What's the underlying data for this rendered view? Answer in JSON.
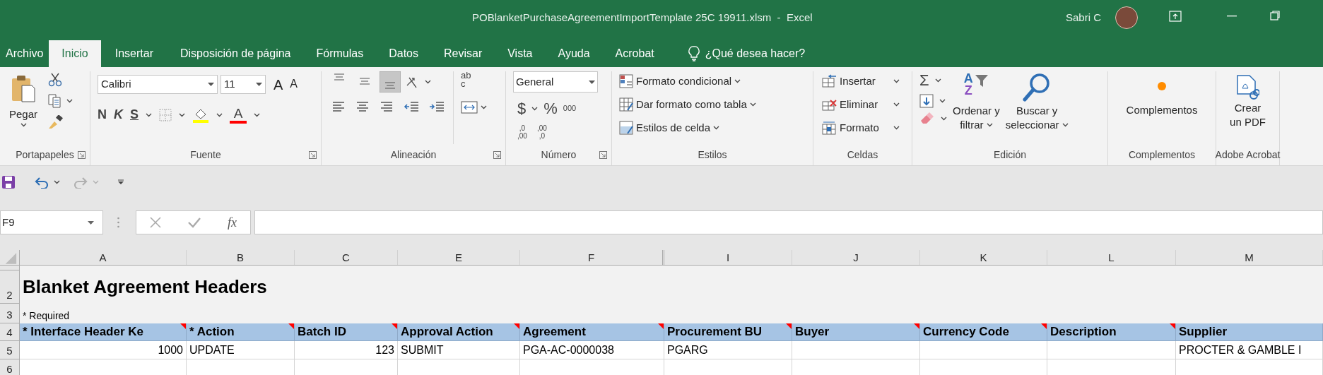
{
  "window": {
    "title": "POBlanketPurchaseAgreementImportTemplate 25C 19911.xlsm  -  Excel",
    "user": "Sabri C"
  },
  "tabs": [
    {
      "label": "Archivo",
      "selected": false
    },
    {
      "label": "Inicio",
      "selected": true
    },
    {
      "label": "Insertar",
      "selected": false
    },
    {
      "label": "Disposición de página",
      "selected": false
    },
    {
      "label": "Fórmulas",
      "selected": false
    },
    {
      "label": "Datos",
      "selected": false
    },
    {
      "label": "Revisar",
      "selected": false
    },
    {
      "label": "Vista",
      "selected": false
    },
    {
      "label": "Ayuda",
      "selected": false
    },
    {
      "label": "Acrobat",
      "selected": false
    }
  ],
  "tell_me": "¿Qué desea hacer?",
  "ribbon": {
    "clipboard": {
      "paste": "Pegar"
    },
    "font": {
      "name": "Calibri",
      "size": "11",
      "grow": "A",
      "shrink": "A",
      "styles": [
        "N",
        "K",
        "S"
      ],
      "color_glyph": "A"
    },
    "alignment": {
      "vertical": [
        {
          "kind": "top",
          "selected": false
        },
        {
          "kind": "middle",
          "selected": false
        },
        {
          "kind": "bottom",
          "selected": true
        }
      ],
      "wrap_glyph": [
        "ab",
        "c"
      ]
    },
    "number": {
      "format": "General",
      "symbols": [
        "$",
        "%",
        "000"
      ],
      "decimals": [
        [
          ",0",
          ",00"
        ],
        [
          ",00",
          ",0"
        ]
      ]
    },
    "styles": [
      "Formato condicional",
      "Dar formato como tabla",
      "Estilos de celda"
    ],
    "cells": [
      "Insertar",
      "Eliminar",
      "Formato"
    ],
    "editing": {
      "sum_glyph": "Σ",
      "sort_glyphs": [
        "A",
        "Z"
      ],
      "sort": [
        "Ordenar y",
        "filtrar"
      ],
      "find": [
        "Buscar y",
        "seleccionar"
      ]
    },
    "addins": "Complementos",
    "acrobat": [
      "Crear",
      "un PDF"
    ],
    "groups": [
      {
        "label": "Portapapeles",
        "launcher": true
      },
      {
        "label": "Fuente",
        "launcher": true
      },
      {
        "label": "Alineación",
        "launcher": true
      },
      {
        "label": "Número",
        "launcher": true
      },
      {
        "label": "Estilos",
        "launcher": false
      },
      {
        "label": "Celdas",
        "launcher": false
      },
      {
        "label": "Edición",
        "launcher": false
      },
      {
        "label": "Complementos",
        "launcher": false
      },
      {
        "label": "Adobe Acrobat",
        "launcher": false
      }
    ]
  },
  "quick_access": {
    "redo_disabled": true
  },
  "formula_bar": {
    "name_box": "F9",
    "fx": "fx"
  },
  "sheet": {
    "columns": [
      "A",
      "B",
      "C",
      "E",
      "F",
      "I",
      "J",
      "K",
      "L",
      "M"
    ],
    "rows": [
      {
        "kind": "spacer"
      },
      {
        "number": "2",
        "kind": "title",
        "text": "Blanket Agreement Headers"
      },
      {
        "number": "3",
        "kind": "note",
        "text": "* Required"
      },
      {
        "number": "4",
        "kind": "header",
        "cells": [
          {
            "text": "* Interface Header Ke",
            "has_comment": true
          },
          {
            "text": "* Action",
            "has_comment": true
          },
          {
            "text": "Batch ID",
            "has_comment": true
          },
          {
            "text": "Approval Action",
            "has_comment": true
          },
          {
            "text": "Agreement",
            "has_comment": true
          },
          {
            "text": "Procurement BU",
            "has_comment": true
          },
          {
            "text": "Buyer",
            "has_comment": true
          },
          {
            "text": "Currency Code",
            "has_comment": true
          },
          {
            "text": "Description",
            "has_comment": true
          },
          {
            "text": "Supplier",
            "has_comment": false
          }
        ]
      },
      {
        "number": "5",
        "kind": "data",
        "cells": [
          {
            "text": "1000",
            "right_aligned": true
          },
          {
            "text": "UPDATE",
            "right_aligned": false
          },
          {
            "text": "123",
            "right_aligned": true
          },
          {
            "text": "SUBMIT",
            "right_aligned": false
          },
          {
            "text": "PGA-AC-0000038",
            "right_aligned": false
          },
          {
            "text": "PGARG",
            "right_aligned": false
          },
          {},
          {},
          {},
          {
            "text": "PROCTER & GAMBLE I",
            "right_aligned": false
          }
        ]
      },
      {
        "number": "6",
        "kind": "blank"
      }
    ]
  }
}
